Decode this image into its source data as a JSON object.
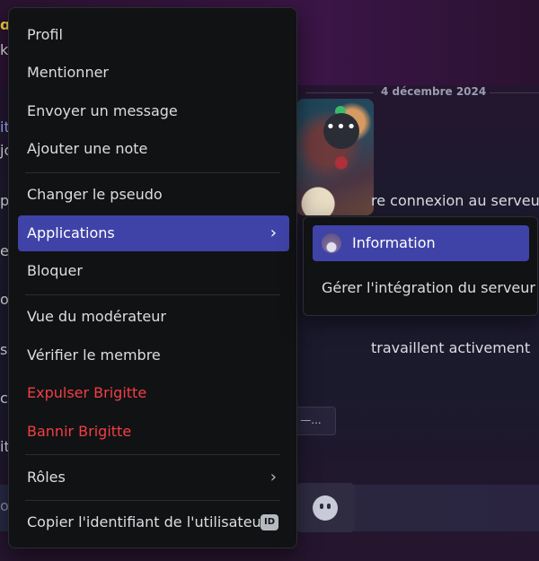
{
  "background": {
    "date_divider": "4 décembre 2024",
    "snippet_connexion": "re connexion au serveu",
    "snippet_travaillent": "travaillent activement",
    "chip_label": "—...",
    "left_fragments": [
      "ɑM",
      "k",
      "it",
      "jo",
      "p",
      "el",
      "o",
      "s",
      "c",
      "it",
      "oy"
    ]
  },
  "context_menu": {
    "items": [
      {
        "label": "Profil"
      },
      {
        "label": "Mentionner"
      },
      {
        "label": "Envoyer un message"
      },
      {
        "label": "Ajouter une note"
      },
      {
        "label": "Changer le pseudo"
      },
      {
        "label": "Applications",
        "has_submenu": true,
        "active": true
      },
      {
        "label": "Bloquer"
      },
      {
        "label": "Vue du modérateur"
      },
      {
        "label": "Vérifier le membre"
      },
      {
        "label": "Expulser Brigitte",
        "danger": true
      },
      {
        "label": "Bannir Brigitte",
        "danger": true
      },
      {
        "label": "Rôles",
        "has_submenu": true
      },
      {
        "label": "Copier l'identifiant de l'utilisateur",
        "badge": "ID"
      }
    ]
  },
  "submenu": {
    "items": [
      {
        "label": "Information",
        "active": true,
        "icon": "app-avatar-icon"
      },
      {
        "label": "Gérer l'intégration du serveur"
      }
    ]
  },
  "colors": {
    "menu_bg": "#111214",
    "active_bg": "#3f43a7",
    "danger_text": "#f23f43",
    "text": "#dbdee1"
  }
}
